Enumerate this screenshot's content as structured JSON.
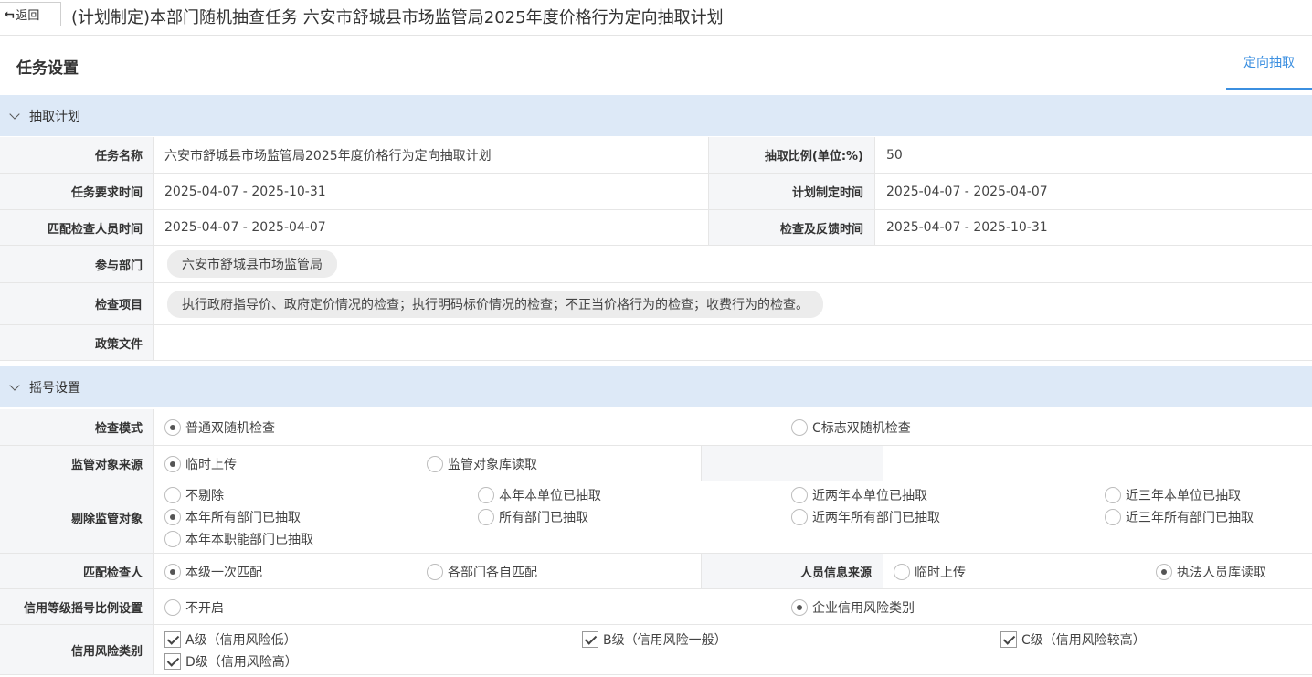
{
  "topbar": {
    "back_label": "返回",
    "title": "(计划制定)本部门随机抽查任务 六安市舒城县市场监管局2025年度价格行为定向抽取计划"
  },
  "taskbar": {
    "title": "任务设置",
    "tab_label": "定向抽取"
  },
  "plan_section": {
    "header": "抽取计划",
    "task_name_label": "任务名称",
    "task_name": "六安市舒城县市场监管局2025年度价格行为定向抽取计划",
    "ratio_label": "抽取比例(单位:%)",
    "ratio": "50",
    "req_time_label": "任务要求时间",
    "req_time": "2025-04-07 - 2025-10-31",
    "plan_time_label": "计划制定时间",
    "plan_time": "2025-04-07 - 2025-04-07",
    "match_time_label": "匹配检查人员时间",
    "match_time": "2025-04-07 - 2025-04-07",
    "feedback_time_label": "检查及反馈时间",
    "feedback_time": "2025-04-07 - 2025-10-31",
    "dept_label": "参与部门",
    "dept_tag": "六安市舒城县市场监管局",
    "items_label": "检查项目",
    "items_tag": "执行政府指导价、政府定价情况的检查；执行明码标价情况的检查；不正当价格行为的检查；收费行为的检查。",
    "policy_label": "政策文件"
  },
  "lottery_section": {
    "header": "摇号设置",
    "mode_label": "检查模式",
    "mode_options": [
      "普通双随机检查",
      "C标志双随机检查"
    ],
    "mode_selected": 0,
    "source_label": "监管对象来源",
    "source_options": [
      "临时上传",
      "监管对象库读取"
    ],
    "source_selected": 0,
    "exclude_label": "剔除监管对象",
    "exclude_options": [
      "不剔除",
      "本年本单位已抽取",
      "近两年本单位已抽取",
      "近三年本单位已抽取",
      "本年所有部门已抽取",
      "所有部门已抽取",
      "近两年所有部门已抽取",
      "近三年所有部门已抽取",
      "本年本职能部门已抽取"
    ],
    "exclude_selected": 4,
    "inspector_label": "匹配检查人",
    "inspector_options": [
      "本级一次匹配",
      "各部门各自匹配"
    ],
    "inspector_selected": 0,
    "personnel_label": "人员信息来源",
    "personnel_options": [
      "临时上传",
      "执法人员库读取"
    ],
    "personnel_selected": 1,
    "credit_ratio_label": "信用等级摇号比例设置",
    "credit_ratio_options": [
      "不开启",
      "企业信用风险类别"
    ],
    "credit_ratio_selected": 1,
    "risk_label": "信用风险类别",
    "risk_options": [
      "A级（信用风险低）",
      "B级（信用风险一般）",
      "C级（信用风险较高）",
      "D级（信用风险高）"
    ],
    "risk_checked": [
      true,
      true,
      true,
      true
    ]
  }
}
